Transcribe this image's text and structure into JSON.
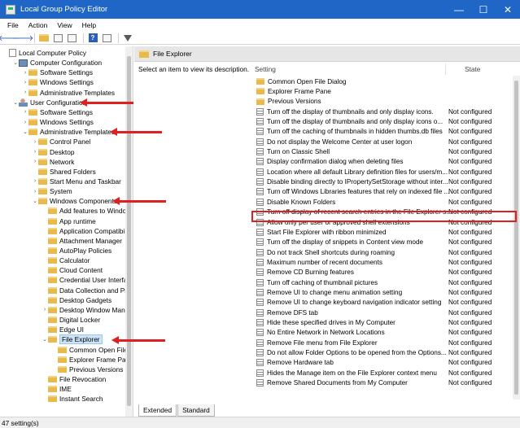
{
  "window": {
    "title": "Local Group Policy Editor",
    "minimize": "—",
    "maximize": "☐",
    "close": "✕"
  },
  "menu": [
    "File",
    "Action",
    "View",
    "Help"
  ],
  "tree": [
    {
      "label": "Local Computer Policy",
      "level": 0,
      "icon": "doc",
      "chev": ""
    },
    {
      "label": "Computer Configuration",
      "level": 1,
      "icon": "comp",
      "chev": "⌄"
    },
    {
      "label": "Software Settings",
      "level": 2,
      "icon": "fold",
      "chev": "›"
    },
    {
      "label": "Windows Settings",
      "level": 2,
      "icon": "fold",
      "chev": "›"
    },
    {
      "label": "Administrative Templates",
      "level": 2,
      "icon": "fold",
      "chev": "›"
    },
    {
      "label": "User Configuration",
      "level": 1,
      "icon": "user",
      "chev": "⌄"
    },
    {
      "label": "Software Settings",
      "level": 2,
      "icon": "fold",
      "chev": "›"
    },
    {
      "label": "Windows Settings",
      "level": 2,
      "icon": "fold",
      "chev": "›"
    },
    {
      "label": "Administrative Templates",
      "level": 2,
      "icon": "fold",
      "chev": "⌄"
    },
    {
      "label": "Control Panel",
      "level": 3,
      "icon": "fold",
      "chev": "›"
    },
    {
      "label": "Desktop",
      "level": 3,
      "icon": "fold",
      "chev": "›"
    },
    {
      "label": "Network",
      "level": 3,
      "icon": "fold",
      "chev": "›"
    },
    {
      "label": "Shared Folders",
      "level": 3,
      "icon": "fold",
      "chev": ""
    },
    {
      "label": "Start Menu and Taskbar",
      "level": 3,
      "icon": "fold",
      "chev": "›"
    },
    {
      "label": "System",
      "level": 3,
      "icon": "fold",
      "chev": "›"
    },
    {
      "label": "Windows Components",
      "level": 3,
      "icon": "fold",
      "chev": "⌄"
    },
    {
      "label": "Add features to Windo",
      "level": 4,
      "icon": "fold",
      "chev": ""
    },
    {
      "label": "App runtime",
      "level": 4,
      "icon": "fold",
      "chev": ""
    },
    {
      "label": "Application Compatibi",
      "level": 4,
      "icon": "fold",
      "chev": ""
    },
    {
      "label": "Attachment Manager",
      "level": 4,
      "icon": "fold",
      "chev": ""
    },
    {
      "label": "AutoPlay Policies",
      "level": 4,
      "icon": "fold",
      "chev": ""
    },
    {
      "label": "Calculator",
      "level": 4,
      "icon": "fold",
      "chev": ""
    },
    {
      "label": "Cloud Content",
      "level": 4,
      "icon": "fold",
      "chev": ""
    },
    {
      "label": "Credential User Interfac",
      "level": 4,
      "icon": "fold",
      "chev": ""
    },
    {
      "label": "Data Collection and Pr",
      "level": 4,
      "icon": "fold",
      "chev": ""
    },
    {
      "label": "Desktop Gadgets",
      "level": 4,
      "icon": "fold",
      "chev": ""
    },
    {
      "label": "Desktop Window Mana",
      "level": 4,
      "icon": "fold",
      "chev": "›"
    },
    {
      "label": "Digital Locker",
      "level": 4,
      "icon": "fold",
      "chev": ""
    },
    {
      "label": "Edge UI",
      "level": 4,
      "icon": "fold",
      "chev": ""
    },
    {
      "label": "File Explorer",
      "level": 4,
      "icon": "fold",
      "chev": "⌄",
      "selected": true
    },
    {
      "label": "Common Open File",
      "level": 5,
      "icon": "fold",
      "chev": ""
    },
    {
      "label": "Explorer Frame Pan",
      "level": 5,
      "icon": "fold",
      "chev": ""
    },
    {
      "label": "Previous Versions",
      "level": 5,
      "icon": "fold",
      "chev": ""
    },
    {
      "label": "File Revocation",
      "level": 4,
      "icon": "fold",
      "chev": ""
    },
    {
      "label": "IME",
      "level": 4,
      "icon": "fold",
      "chev": ""
    },
    {
      "label": "Instant Search",
      "level": 4,
      "icon": "fold",
      "chev": ""
    }
  ],
  "right": {
    "header": "File Explorer",
    "description": "Select an item to view its description.",
    "col_setting": "Setting",
    "col_state": "State",
    "rows": [
      {
        "name": "Common Open File Dialog",
        "state": "",
        "type": "folder"
      },
      {
        "name": "Explorer Frame Pane",
        "state": "",
        "type": "folder"
      },
      {
        "name": "Previous Versions",
        "state": "",
        "type": "folder"
      },
      {
        "name": "Turn off the display of thumbnails and only display icons.",
        "state": "Not configured",
        "type": "policy"
      },
      {
        "name": "Turn off the display of thumbnails and only display icons o...",
        "state": "Not configured",
        "type": "policy"
      },
      {
        "name": "Turn off the caching of thumbnails in hidden thumbs.db files",
        "state": "Not configured",
        "type": "policy"
      },
      {
        "name": "Do not display the Welcome Center at user logon",
        "state": "Not configured",
        "type": "policy"
      },
      {
        "name": "Turn on Classic Shell",
        "state": "Not configured",
        "type": "policy"
      },
      {
        "name": "Display confirmation dialog when deleting files",
        "state": "Not configured",
        "type": "policy"
      },
      {
        "name": "Location where all default Library definition files for users/m...",
        "state": "Not configured",
        "type": "policy"
      },
      {
        "name": "Disable binding directly to IPropertySetStorage without inter...",
        "state": "Not configured",
        "type": "policy"
      },
      {
        "name": "Turn off Windows Libraries features that rely on indexed file ...",
        "state": "Not configured",
        "type": "policy"
      },
      {
        "name": "Disable Known Folders",
        "state": "Not configured",
        "type": "policy"
      },
      {
        "name": "Turn off display of recent search entries in the File Explorer s...",
        "state": "Not configured",
        "type": "policy"
      },
      {
        "name": "Allow only per user or approved shell extensions",
        "state": "Not configured",
        "type": "policy"
      },
      {
        "name": "Start File Explorer with ribbon minimized",
        "state": "Not configured",
        "type": "policy"
      },
      {
        "name": "Turn off the display of snippets in Content view mode",
        "state": "Not configured",
        "type": "policy"
      },
      {
        "name": "Do not track Shell shortcuts during roaming",
        "state": "Not configured",
        "type": "policy"
      },
      {
        "name": "Maximum number of recent documents",
        "state": "Not configured",
        "type": "policy"
      },
      {
        "name": "Remove CD Burning features",
        "state": "Not configured",
        "type": "policy"
      },
      {
        "name": "Turn off caching of thumbnail pictures",
        "state": "Not configured",
        "type": "policy"
      },
      {
        "name": "Remove UI to change menu animation setting",
        "state": "Not configured",
        "type": "policy"
      },
      {
        "name": "Remove UI to change keyboard navigation indicator setting",
        "state": "Not configured",
        "type": "policy"
      },
      {
        "name": "Remove DFS tab",
        "state": "Not configured",
        "type": "policy"
      },
      {
        "name": "Hide these specified drives in My Computer",
        "state": "Not configured",
        "type": "policy"
      },
      {
        "name": "No Entire Network in Network Locations",
        "state": "Not configured",
        "type": "policy"
      },
      {
        "name": "Remove File menu from File Explorer",
        "state": "Not configured",
        "type": "policy"
      },
      {
        "name": "Do not allow Folder Options to be opened from the Options...",
        "state": "Not configured",
        "type": "policy"
      },
      {
        "name": "Remove Hardware tab",
        "state": "Not configured",
        "type": "policy"
      },
      {
        "name": "Hides the Manage item on the File Explorer context menu",
        "state": "Not configured",
        "type": "policy"
      },
      {
        "name": "Remove Shared Documents from My Computer",
        "state": "Not configured",
        "type": "policy"
      }
    ],
    "tabs": [
      "Extended",
      "Standard"
    ]
  },
  "status": "47 setting(s)",
  "colors": {
    "titlebar": "#1f66c7",
    "annotation_red": "#e02020",
    "selection": "#cce4f7"
  }
}
